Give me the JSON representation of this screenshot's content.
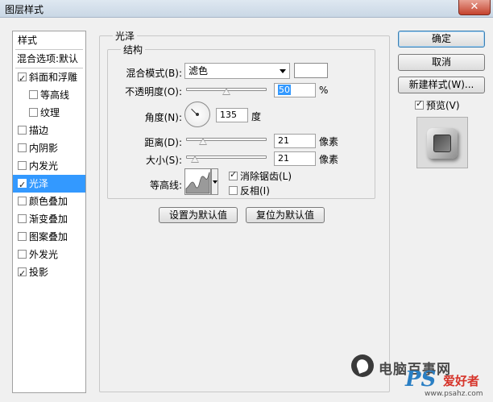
{
  "window": {
    "title": "图层样式",
    "close_glyph": "✕"
  },
  "styles_list": {
    "header": "样式",
    "blend_options": "混合选项:默认",
    "items": [
      {
        "label": "斜面和浮雕",
        "checked": true,
        "indent": false
      },
      {
        "label": "等高线",
        "checked": false,
        "indent": true
      },
      {
        "label": "纹理",
        "checked": false,
        "indent": true
      },
      {
        "label": "描边",
        "checked": false,
        "indent": false
      },
      {
        "label": "内阴影",
        "checked": false,
        "indent": false
      },
      {
        "label": "内发光",
        "checked": false,
        "indent": false
      },
      {
        "label": "光泽",
        "checked": true,
        "indent": false,
        "selected": true
      },
      {
        "label": "颜色叠加",
        "checked": false,
        "indent": false
      },
      {
        "label": "渐变叠加",
        "checked": false,
        "indent": false
      },
      {
        "label": "图案叠加",
        "checked": false,
        "indent": false
      },
      {
        "label": "外发光",
        "checked": false,
        "indent": false
      },
      {
        "label": "投影",
        "checked": true,
        "indent": false
      }
    ]
  },
  "panel": {
    "title": "光泽",
    "group_title": "结构",
    "blend_mode_label": "混合模式(B):",
    "blend_mode_value": "滤色",
    "blend_color": "#ffffff",
    "opacity_label": "不透明度(O):",
    "opacity_value": "50",
    "opacity_unit": "%",
    "angle_label": "角度(N):",
    "angle_value": "135",
    "angle_unit": "度",
    "distance_label": "距离(D):",
    "distance_value": "21",
    "distance_unit": "像素",
    "size_label": "大小(S):",
    "size_value": "21",
    "size_unit": "像素",
    "contour_label": "等高线:",
    "anti_alias_label": "消除锯齿(L)",
    "anti_alias_checked": true,
    "invert_label": "反相(I)",
    "invert_checked": false,
    "set_default_button": "设置为默认值",
    "reset_default_button": "复位为默认值"
  },
  "right_buttons": {
    "ok": "确定",
    "cancel": "取消",
    "new_style": "新建样式(W)...",
    "preview_label": "预览(V)",
    "preview_checked": true
  },
  "watermark": {
    "site_name": "电脑百事网",
    "brand_ps": "PS",
    "brand_cn": "爱好者",
    "url": "www.psahz.com"
  }
}
